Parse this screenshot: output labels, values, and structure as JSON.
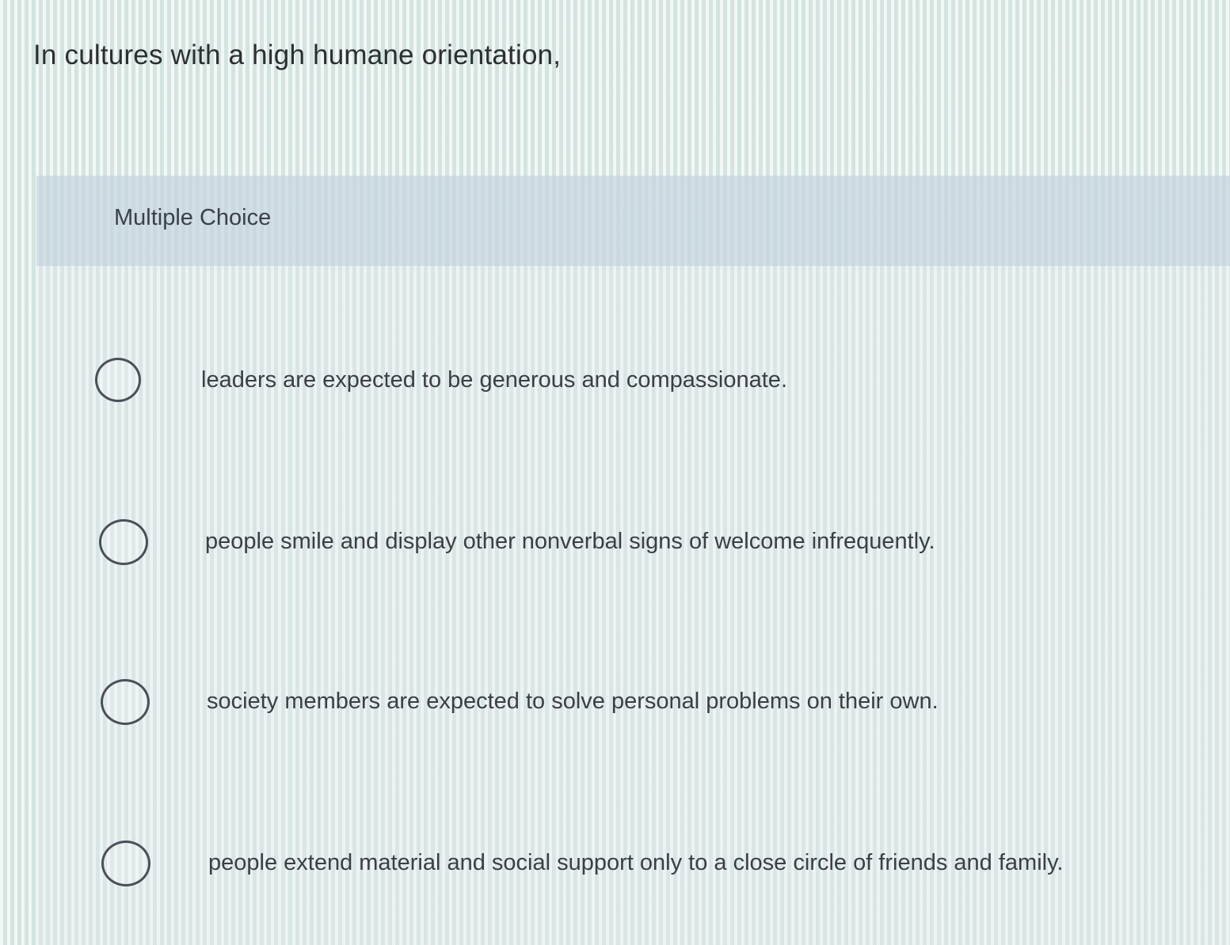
{
  "question": {
    "text": "In cultures with a high humane orientation,"
  },
  "answer_panel": {
    "header_label": "Multiple Choice",
    "choices": [
      {
        "label": "leaders are expected to be generous and compassionate.",
        "selected": false
      },
      {
        "label": "people smile and display other nonverbal signs of welcome infrequently.",
        "selected": false
      },
      {
        "label": "society members are expected to solve personal problems on their own.",
        "selected": false
      },
      {
        "label": "people extend material and social support only to a close circle of friends and family.",
        "selected": false
      }
    ]
  },
  "colors": {
    "text": "#2f3437",
    "header_band": "#bfcedc",
    "radio_border": "#4a5057"
  },
  "icons": {
    "choice_radio": "radio-unchecked-icon"
  }
}
